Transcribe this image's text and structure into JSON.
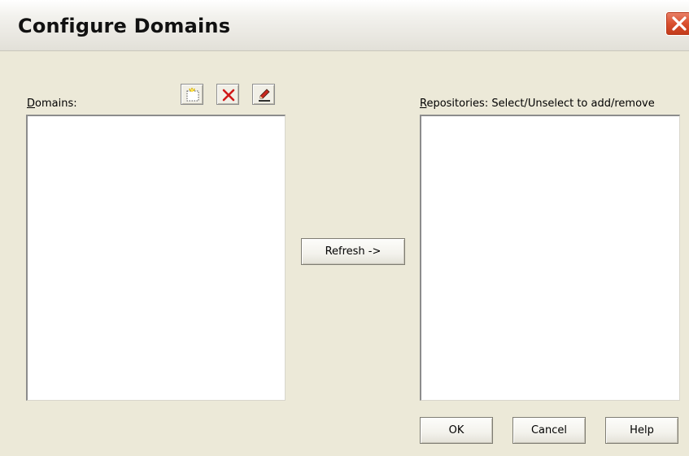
{
  "dialog": {
    "title": "Configure Domains"
  },
  "domains": {
    "label_accesskey": "D",
    "label_rest": "omains:",
    "items": []
  },
  "repositories": {
    "label_accesskey": "R",
    "label_rest": "epositories: Select/Unselect to add/remove",
    "items": []
  },
  "toolbar": {
    "new_icon": "new-domain-icon",
    "delete_icon": "delete-x-icon",
    "edit_icon": "edit-pencil-icon"
  },
  "buttons": {
    "refresh_accesskey": "R",
    "refresh_rest": "efresh ->",
    "ok_accesskey": "O",
    "ok_rest": "K",
    "cancel_accesskey": "C",
    "cancel_rest": "ancel",
    "help_accesskey": "H",
    "help_rest": "elp"
  },
  "colors": {
    "face": "#ece9d8",
    "close_red": "#d9502f",
    "delete_red": "#d01818"
  }
}
